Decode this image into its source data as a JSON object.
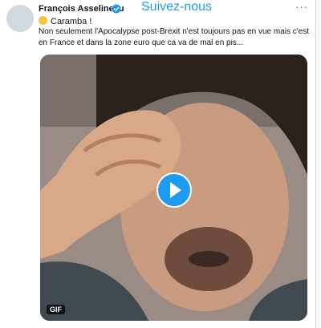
{
  "tweet": {
    "author_name": "François Asselineau",
    "follow_banner": "Suivez-nous",
    "more_label": "···",
    "first_line": "Caramba !",
    "emoji_name": "sweat-smile-emoji",
    "body": "Non seulement l'Apocalypse post-Brexit n'est toujours pas en vue mais c'est en France et dans la zone euro que ca va de mal en pis...",
    "media": {
      "type": "GIF",
      "badge": "GIF",
      "play_icon": "play-icon"
    }
  },
  "colors": {
    "accent": "#1d9bf0",
    "text": "#0f1419",
    "muted": "#536471"
  }
}
